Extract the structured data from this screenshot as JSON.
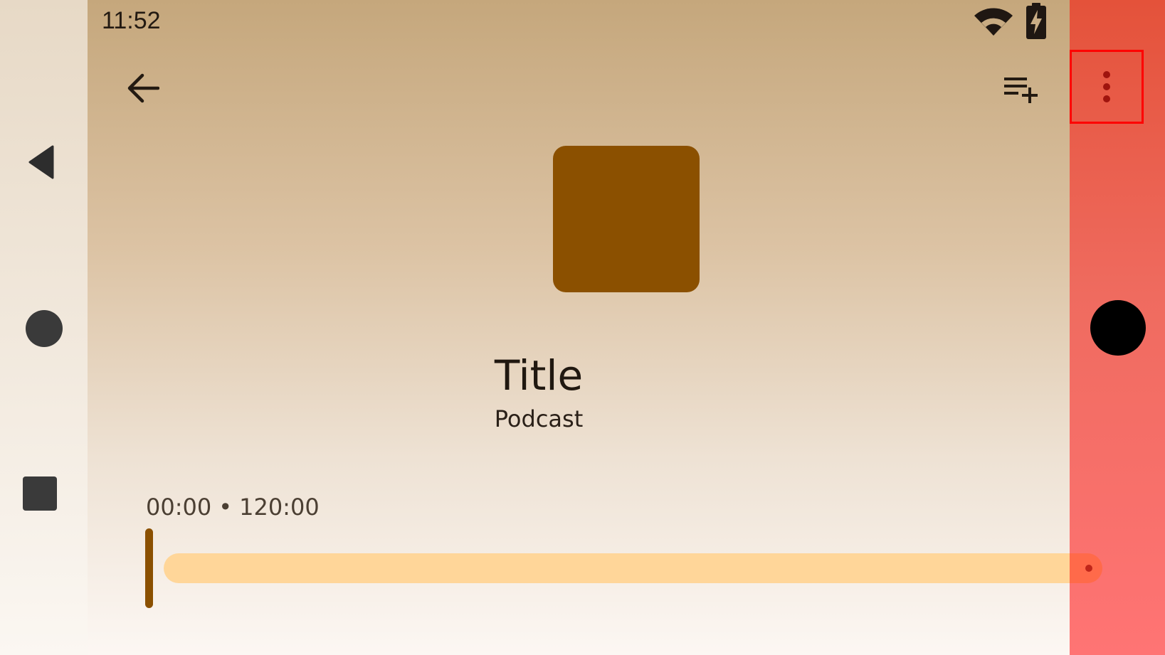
{
  "status_bar": {
    "time": "11:52",
    "wifi_icon": "wifi-icon",
    "battery_icon": "battery-charging-icon"
  },
  "toolbar": {
    "back_icon": "arrow-back-icon",
    "add_to_queue_icon": "playlist-add-icon",
    "more_icon": "more-vert-icon"
  },
  "episode": {
    "title": "Title",
    "podcast": "Podcast",
    "artwork_color": "#8b5000"
  },
  "player": {
    "elapsed": "00:00",
    "separator": "•",
    "duration": "120:00",
    "progress_fraction": 0.0,
    "handle_color": "#8b5000",
    "track_color": "#ffd699"
  },
  "navigation": {
    "back_icon": "nav-back-triangle-icon",
    "home_icon": "nav-home-circle-icon",
    "recents_icon": "nav-recents-square-icon"
  },
  "colors": {
    "overlay": "#ef6b5f",
    "highlight_border": "#ff0000",
    "icon_dark": "#231a12"
  }
}
